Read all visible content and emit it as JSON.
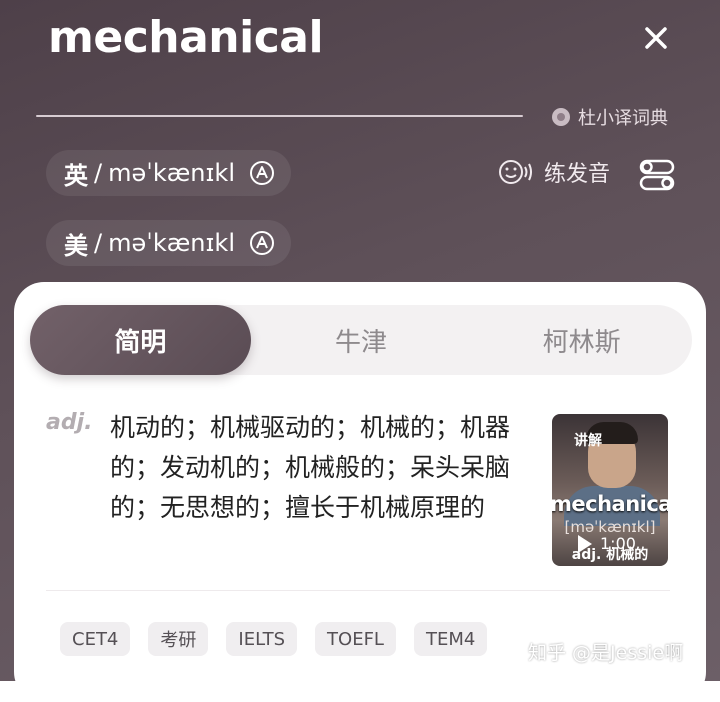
{
  "header": {
    "word": "mechanical",
    "brand": "杜小译词典",
    "practice_label": "练发音"
  },
  "pronunciations": [
    {
      "lang": "英",
      "sep": "/",
      "ipa": "məˈkænɪkl"
    },
    {
      "lang": "美",
      "sep": "/",
      "ipa": "məˈkænɪkl"
    }
  ],
  "tabs": [
    "简明",
    "牛津",
    "柯林斯"
  ],
  "definition": {
    "pos": "adj.",
    "text": "机动的；机械驱动的；机械的；机器的；发动机的；机械般的；呆头呆脑的；无思想的；擅长于机械原理的"
  },
  "video": {
    "label": "讲解",
    "word": "mechanical",
    "ipa": "[məˈkænɪkl]",
    "duration": "1:00",
    "caption": "adj. 机械的"
  },
  "tags": [
    "CET4",
    "考研",
    "IELTS",
    "TOEFL",
    "TEM4"
  ],
  "watermark": "知乎 @是Jessie啊",
  "colors": {
    "header": "#5f5159",
    "accent": "#5a4c54"
  }
}
